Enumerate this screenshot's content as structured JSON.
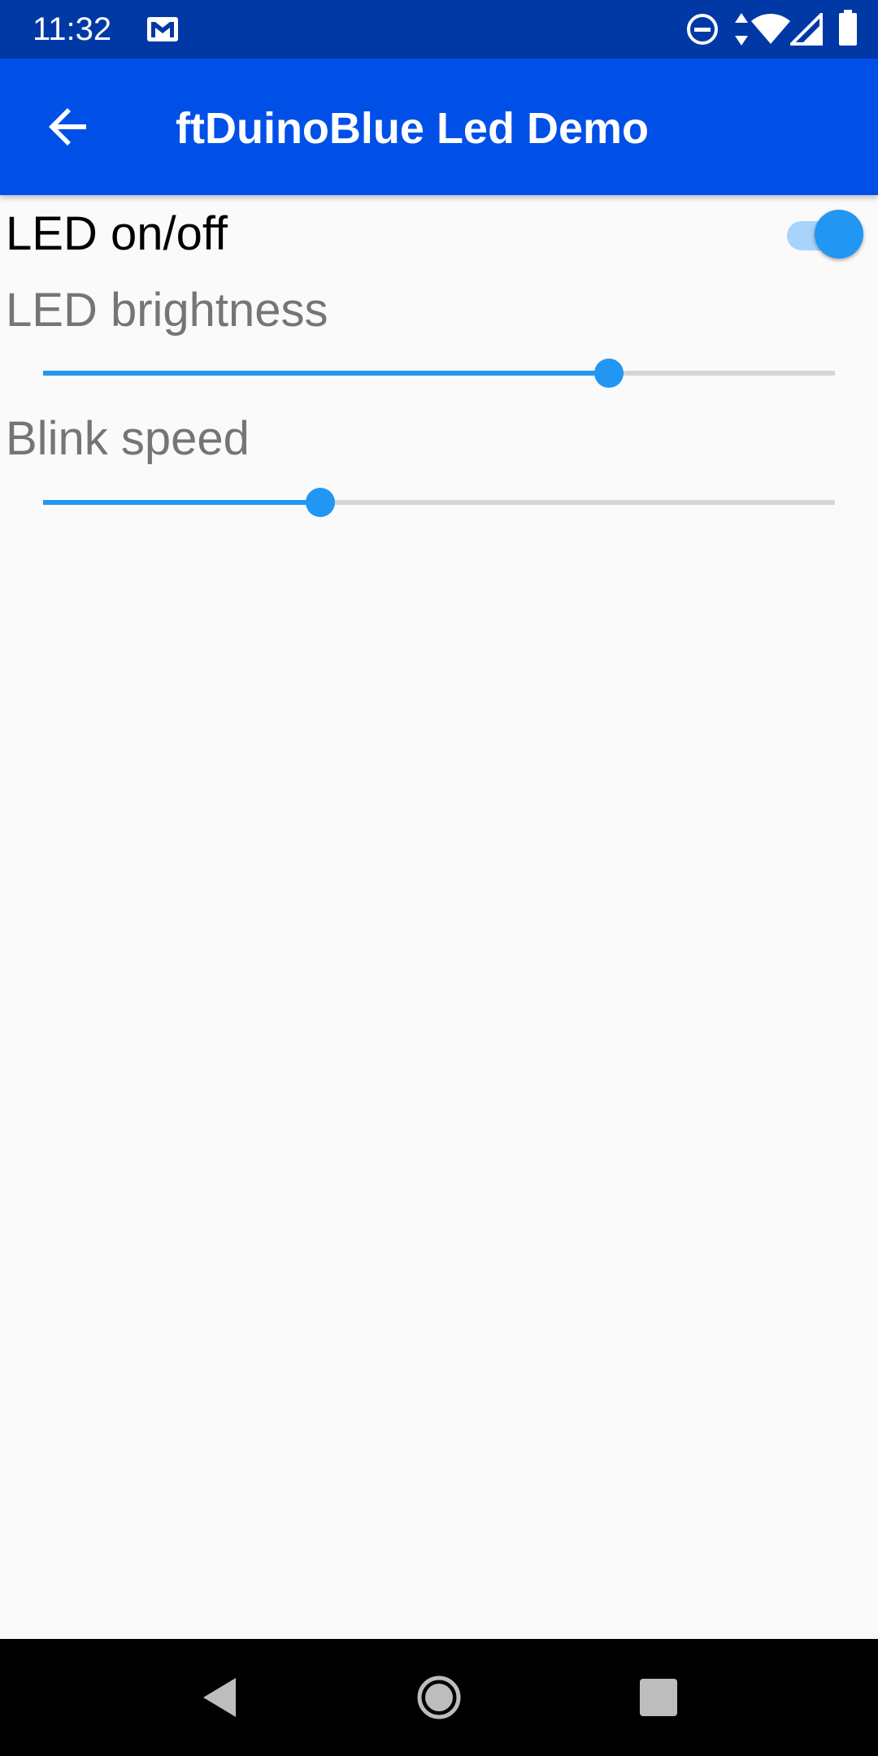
{
  "status_bar": {
    "time": "11:32",
    "icons": [
      "gmail-icon",
      "do-not-disturb-icon",
      "data-arrows-icon",
      "wifi-icon",
      "cell-signal-icon",
      "battery-icon"
    ]
  },
  "app_bar": {
    "title": "ftDuinoBlue Led Demo",
    "back_icon": "arrow-back-icon"
  },
  "controls": {
    "led_switch": {
      "label": "LED on/off",
      "checked": true
    },
    "brightness": {
      "label": "LED brightness",
      "value_fraction": 0.715
    },
    "blink_speed": {
      "label": "Blink speed",
      "value_fraction": 0.35
    }
  },
  "nav_bar": {
    "icons": [
      "nav-back-icon",
      "nav-home-icon",
      "nav-recents-icon"
    ]
  },
  "colors": {
    "status_bar": "#0039a6",
    "app_bar": "#0050e8",
    "accent": "#2196f3",
    "switch_track": "#a8d3fb",
    "slider_track": "#d6d6d6",
    "background": "#fafafa",
    "secondary_text": "#757575"
  }
}
